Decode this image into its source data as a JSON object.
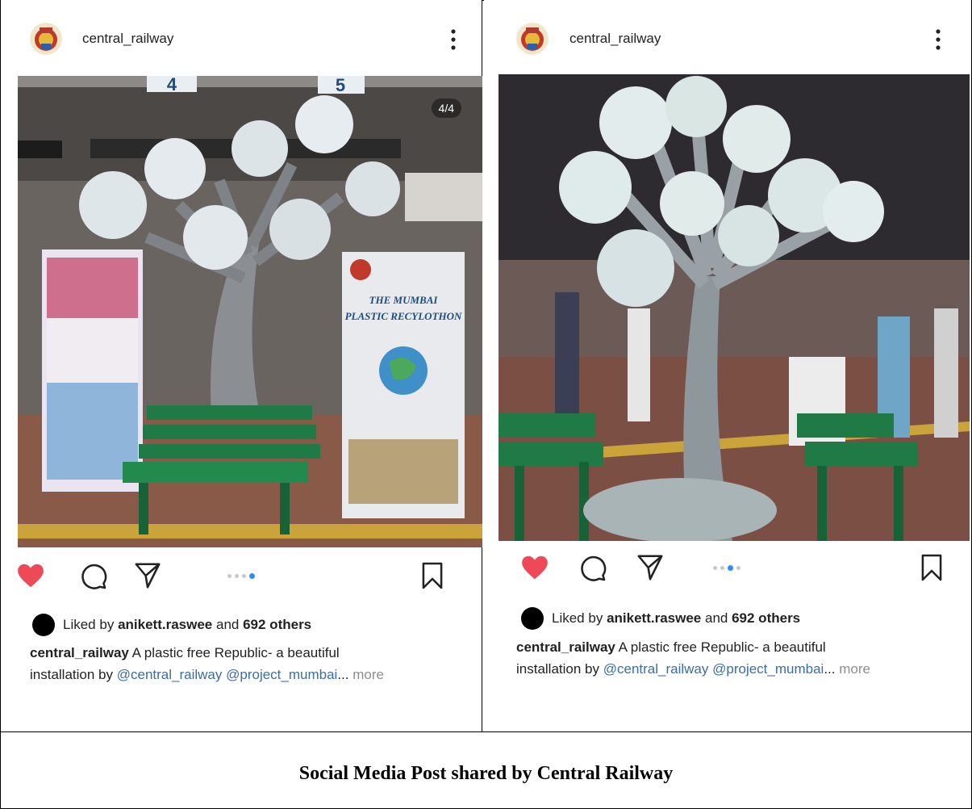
{
  "posts": [
    {
      "username": "central_railway",
      "slide_counter": "4/4",
      "slide_count": 4,
      "active_slide": 4,
      "liked": true,
      "likes": {
        "prefix": "Liked by",
        "liker": "anikett.raswee",
        "joiner": "and",
        "others": "692 others"
      },
      "caption": {
        "user": "central_railway",
        "text_1": "A plastic free Republic- a beautiful",
        "text_2": "installation by",
        "mention_1": "@central_railway",
        "mention_2": "@project_mumbai",
        "ellipsis": "...",
        "more": "more"
      },
      "photo_text": {
        "platform_a": "4",
        "platform_b": "5",
        "banner_title_1": "THE MUMBAI",
        "banner_title_2": "PLASTIC RECYLOTHON"
      }
    },
    {
      "username": "central_railway",
      "slide_count": 4,
      "active_slide": 3,
      "liked": true,
      "likes": {
        "prefix": "Liked by",
        "liker": "anikett.raswee",
        "joiner": "and",
        "others": "692 others"
      },
      "caption": {
        "user": "central_railway",
        "text_1": "A plastic free Republic- a beautiful",
        "text_2": "installation by",
        "mention_1": "@central_railway",
        "mention_2": "@project_mumbai",
        "ellipsis": "...",
        "more": "more"
      }
    }
  ],
  "icons": [
    "more-vertical-icon",
    "heart-icon",
    "comment-icon",
    "share-icon",
    "bookmark-icon"
  ],
  "colors": {
    "heart": "#ed4956",
    "active_dot": "#2f8ff0",
    "mention": "#3a6ea5",
    "bench": "#1f7a45"
  },
  "figure_caption": "Social Media Post shared by Central Railway"
}
